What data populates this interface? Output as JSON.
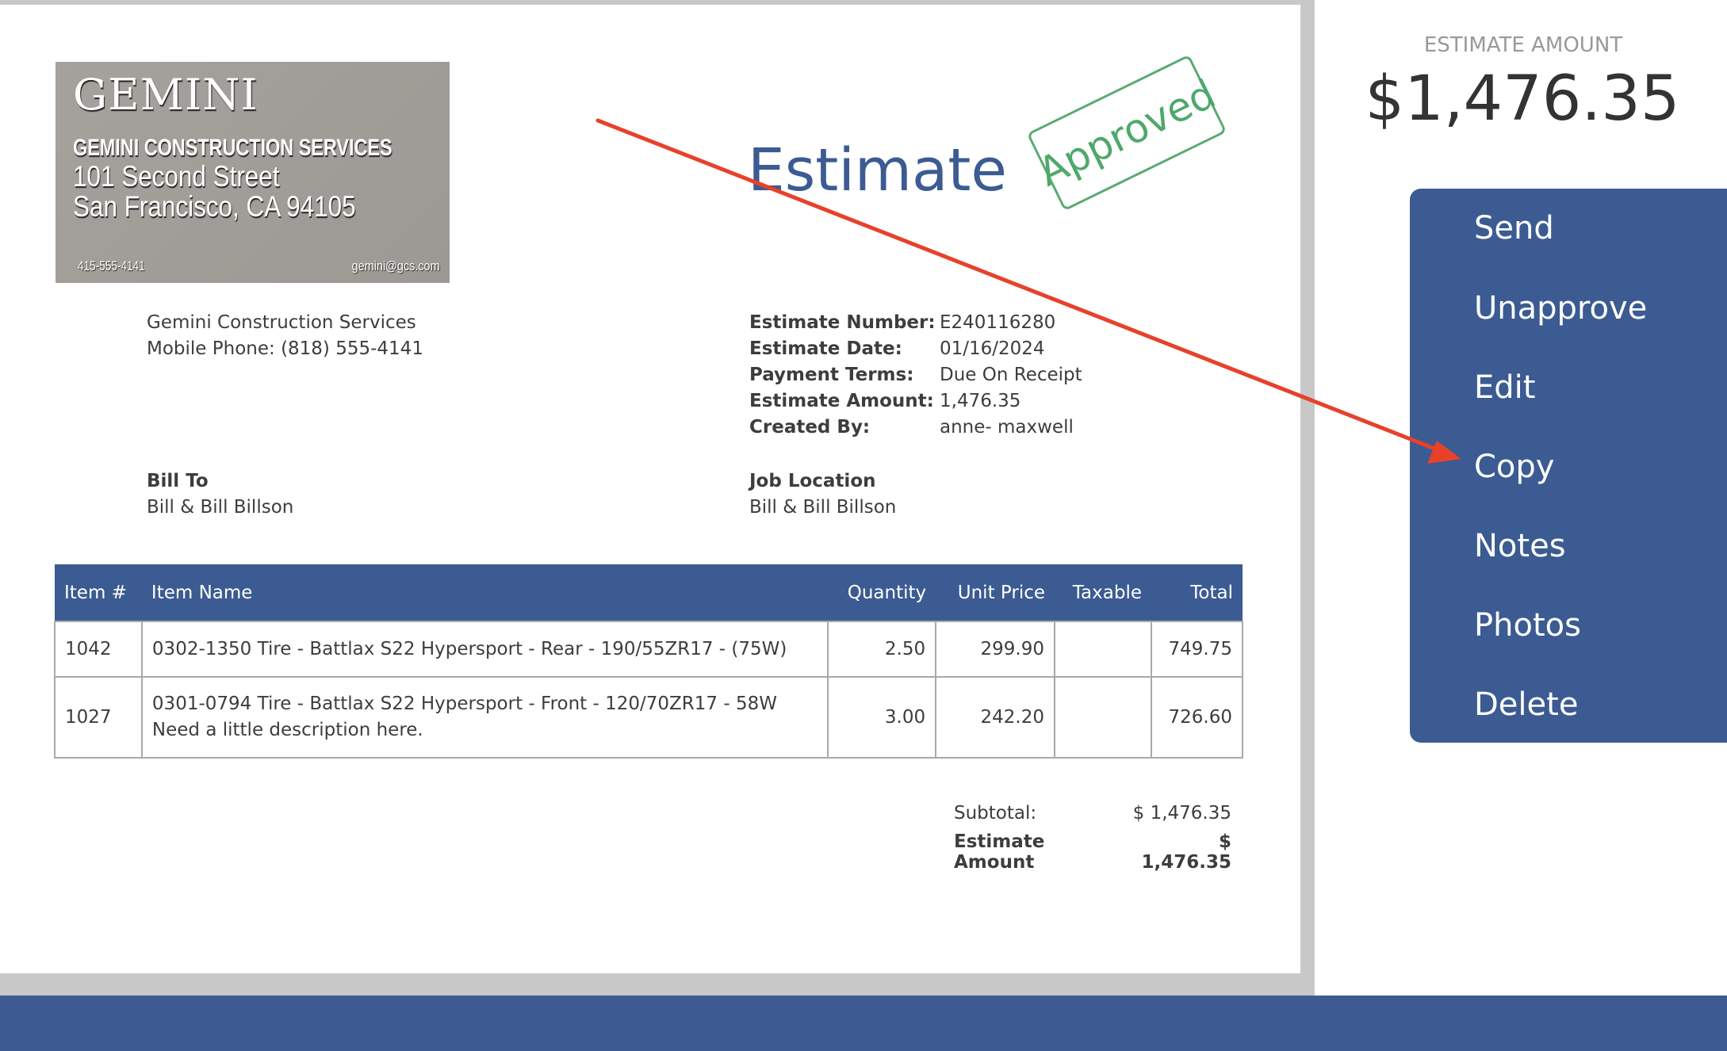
{
  "logo": {
    "brand": "GEMINI",
    "company": "GEMINI CONSTRUCTION SERVICES",
    "address_line1": "101 Second Street",
    "address_line2": "San Francisco, CA  94105",
    "phone": "415-555-4141",
    "email": "gemini@gcs.com"
  },
  "document": {
    "title": "Estimate",
    "stamp": "Approved",
    "from": {
      "name": "Gemini Construction Services",
      "phone": "Mobile Phone: (818) 555-4141"
    },
    "meta": [
      {
        "label": "Estimate Number:",
        "value": "E240116280"
      },
      {
        "label": "Estimate Date:",
        "value": "01/16/2024"
      },
      {
        "label": "Payment Terms:",
        "value": "Due On Receipt"
      },
      {
        "label": "Estimate Amount:",
        "value": "1,476.35"
      },
      {
        "label": "Created By:",
        "value": "anne- maxwell"
      }
    ],
    "bill_to": {
      "label": "Bill To",
      "value": "Bill & Bill Billson"
    },
    "job_location": {
      "label": "Job Location",
      "value": "Bill & Bill Billson"
    },
    "table": {
      "headers": [
        "Item #",
        "Item Name",
        "Quantity",
        "Unit Price",
        "Taxable",
        "Total"
      ],
      "rows": [
        {
          "item": "1042",
          "name": "0302-1350 Tire - Battlax S22 Hypersport - Rear - 190/55ZR17 - (75W)",
          "description": "",
          "quantity": "2.50",
          "unit_price": "299.90",
          "taxable": "",
          "total": "749.75"
        },
        {
          "item": "1027",
          "name": "0301-0794 Tire - Battlax S22 Hypersport - Front - 120/70ZR17 - 58W",
          "description": "Need a little description here.",
          "quantity": "3.00",
          "unit_price": "242.20",
          "taxable": "",
          "total": "726.60"
        }
      ]
    },
    "totals": {
      "subtotal_label": "Subtotal:",
      "subtotal_value": "$ 1,476.35",
      "amount_label": "Estimate Amount",
      "amount_value": "$ 1,476.35"
    }
  },
  "sidebar": {
    "amount_label": "ESTIMATE AMOUNT",
    "amount_value": "$1,476.35",
    "menu": [
      "Send",
      "Unapprove",
      "Edit",
      "Copy",
      "Notes",
      "Photos",
      "Delete"
    ]
  },
  "annotation": {
    "type": "arrow",
    "color": "#e8412a",
    "points_to": "Copy"
  },
  "colors": {
    "brand_blue": "#3b5b92",
    "approved_green": "#4ea86b",
    "frame_gray": "#c7c8c7"
  }
}
